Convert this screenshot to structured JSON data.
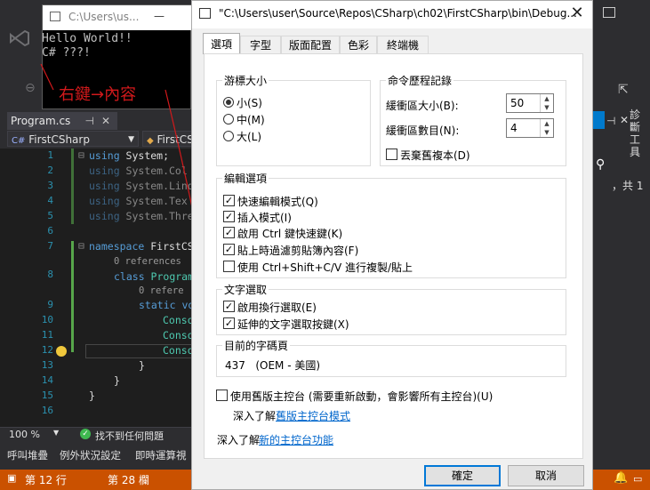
{
  "console": {
    "title": "C:\\Users\\us...",
    "minimize": "—",
    "output_line1": "Hello World!!",
    "output_line2": "C# ???!"
  },
  "annotation": "右鍵→內容",
  "vs": {
    "file_tab": "Program.cs",
    "nav_left": "FirstCSharp",
    "nav_right": "FirstCS",
    "zoom": "100 %",
    "issues": "找不到任何問題",
    "bottom_tabs": [
      "呼叫堆疊",
      "例外狀況設定",
      "即時運算視"
    ],
    "status_line": "第 12 行",
    "status_col": "第 28 欄",
    "right_panel_label": "診斷工具",
    "right_partial": "，共 1",
    "line_numbers": [
      "1",
      "2",
      "3",
      "4",
      "5",
      "6",
      "7",
      "8",
      "9",
      "10",
      "11",
      "12",
      "13",
      "14",
      "15",
      "16"
    ],
    "code": {
      "l1a": "using",
      "l1b": " System;",
      "l2a": "using",
      "l2b": " System.Col",
      "l3a": "using",
      "l3b": " System.Linq",
      "l4a": "using",
      "l4b": " System.Tex",
      "l5a": "using",
      "l5b": " System.Thre",
      "l7a": "namespace",
      "l7b": " FirstCS",
      "ref1": "0 references",
      "l8a": "class",
      "l8b": " Program",
      "ref2": "0 refere",
      "l9a": "static",
      "l9b": " vo",
      "l10": "Conso",
      "l11": "Conso",
      "l12": "Conso",
      "brace13": "}",
      "brace14": "}",
      "brace15": "}"
    }
  },
  "dialog": {
    "title": "\"C:\\Users\\user\\Source\\Repos\\CSharp\\ch02\\FirstCSharp\\bin\\Debug...",
    "tabs": [
      "選項",
      "字型",
      "版面配置",
      "色彩",
      "終端機"
    ],
    "cursor_group": {
      "label": "游標大小",
      "options": [
        "小(S)",
        "中(M)",
        "大(L)"
      ],
      "selected": "小(S)"
    },
    "history_group": {
      "label": "命令歷程記錄",
      "buffer_size_label": "緩衝區大小(B):",
      "buffer_size": "50",
      "buffer_count_label": "緩衝區數目(N):",
      "buffer_count": "4",
      "discard_label": "丟棄舊複本(D)"
    },
    "edit_group": {
      "label": "編輯選項",
      "items": [
        {
          "label": "快速編輯模式(Q)",
          "checked": true
        },
        {
          "label": "插入模式(I)",
          "checked": true
        },
        {
          "label": "啟用 Ctrl 鍵快速鍵(K)",
          "checked": true
        },
        {
          "label": "貼上時過濾剪貼簿內容(F)",
          "checked": true
        },
        {
          "label": "使用 Ctrl+Shift+C/V 進行複製/貼上",
          "checked": false
        }
      ]
    },
    "text_select_group": {
      "label": "文字選取",
      "items": [
        {
          "label": "啟用換行選取(E)",
          "checked": true
        },
        {
          "label": "延伸的文字選取按鍵(X)",
          "checked": true
        }
      ]
    },
    "codepage_group": {
      "label": "目前的字碼頁",
      "value": "437   (OEM - 美國)"
    },
    "legacy_label": "使用舊版主控台 (需要重新啟動，會影響所有主控台)(U)",
    "learn_legacy_prefix": "深入了解",
    "learn_legacy_link": "舊版主控台模式",
    "learn_new_prefix": "深入了解",
    "learn_new_link": "新的主控台功能",
    "ok": "確定",
    "cancel": "取消"
  }
}
